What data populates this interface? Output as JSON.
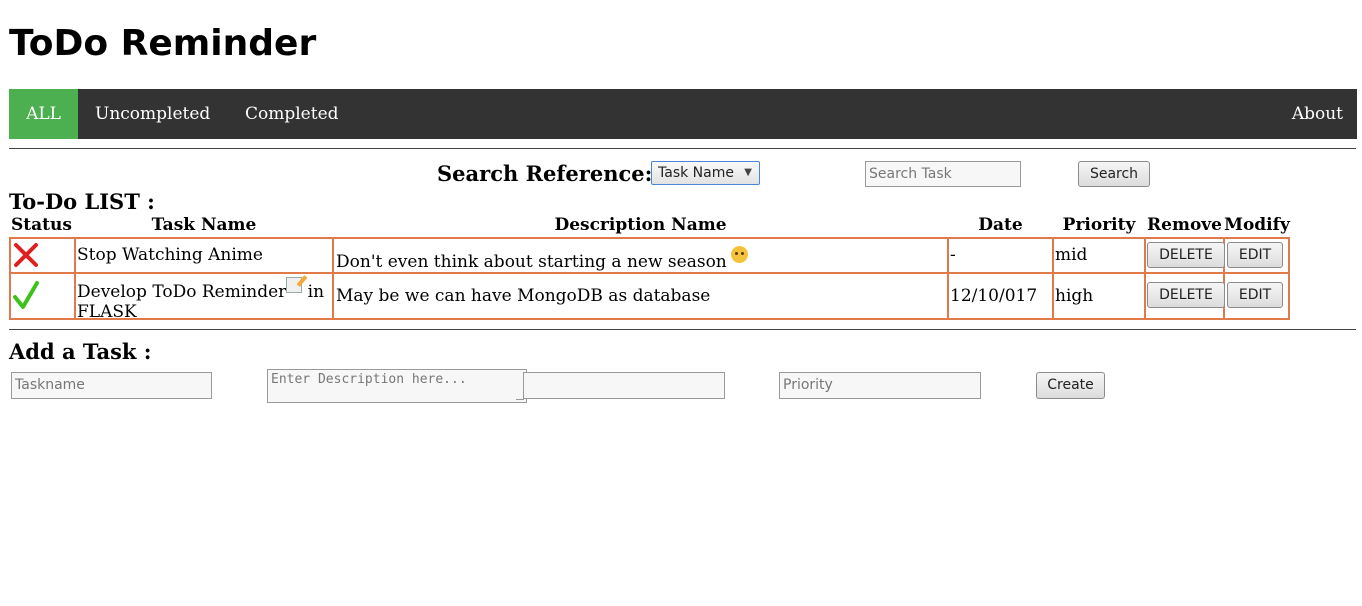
{
  "app": {
    "title": "ToDo Reminder"
  },
  "nav": {
    "items": [
      {
        "label": "ALL",
        "active": true
      },
      {
        "label": "Uncompleted",
        "active": false
      },
      {
        "label": "Completed",
        "active": false
      }
    ],
    "about_label": "About",
    "bar_color": "#333333",
    "active_color": "#4caf50"
  },
  "search": {
    "label": "Search Reference:",
    "reference_selected": "Task Name",
    "input_placeholder": "Search Task",
    "button_label": "Search"
  },
  "todo_list": {
    "title": "To-Do LIST :",
    "columns": [
      "Status",
      "Task Name",
      "Description Name",
      "Date",
      "Priority",
      "Remove",
      "Modify"
    ],
    "rows": [
      {
        "status": "uncompleted",
        "status_icon": "red-cross-icon",
        "task_name": "Stop Watching Anime",
        "description": "Don't even think about starting a new season",
        "description_icon": "angry-face-emoji",
        "date": "-",
        "priority": "mid",
        "delete_label": "DELETE",
        "edit_label": "EDIT"
      },
      {
        "status": "completed",
        "status_icon": "green-check-icon",
        "task_name_part1": "Develop ToDo Reminder",
        "task_name_icon": "memo-icon",
        "task_name_part2": " in",
        "task_name_part3": "FLASK",
        "description": "May be we can have MongoDB as database",
        "date": "12/10/017",
        "priority": "high",
        "delete_label": "DELETE",
        "edit_label": "EDIT"
      }
    ],
    "border_color": "#e07a4a"
  },
  "add_task": {
    "title": "Add a Task :",
    "taskname_placeholder": "Taskname",
    "description_placeholder": "Enter Description here...",
    "date_value": "",
    "priority_placeholder": "Priority",
    "create_label": "Create"
  }
}
